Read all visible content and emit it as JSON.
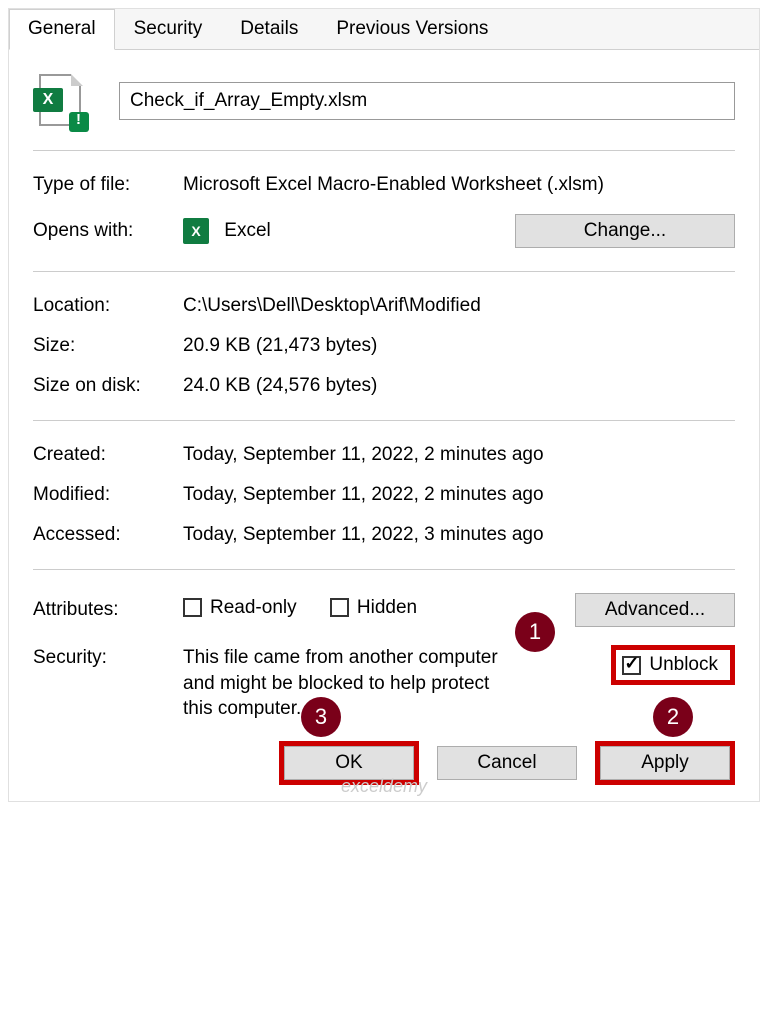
{
  "tabs": {
    "general": "General",
    "security": "Security",
    "details": "Details",
    "previous": "Previous Versions"
  },
  "filename": "Check_if_Array_Empty.xlsm",
  "rows": {
    "typeLabel": "Type of file:",
    "typeValue": "Microsoft Excel Macro-Enabled Worksheet (.xlsm)",
    "opensLabel": "Opens with:",
    "opensApp": "Excel",
    "changeBtn": "Change...",
    "locationLabel": "Location:",
    "locationValue": "C:\\Users\\Dell\\Desktop\\Arif\\Modified",
    "sizeLabel": "Size:",
    "sizeValue": "20.9 KB (21,473 bytes)",
    "diskLabel": "Size on disk:",
    "diskValue": "24.0 KB (24,576 bytes)",
    "createdLabel": "Created:",
    "createdValue": "Today, September 11, 2022, 2 minutes ago",
    "modifiedLabel": "Modified:",
    "modifiedValue": "Today, September 11, 2022, 2 minutes ago",
    "accessedLabel": "Accessed:",
    "accessedValue": "Today, September 11, 2022, 3 minutes ago",
    "attrLabel": "Attributes:",
    "readonly": "Read-only",
    "hidden": "Hidden",
    "advancedBtn": "Advanced...",
    "securityLabel": "Security:",
    "securityText": "This file came from another computer and might be blocked to help protect this computer.",
    "unblock": "Unblock"
  },
  "footer": {
    "ok": "OK",
    "cancel": "Cancel",
    "apply": "Apply"
  },
  "badges": {
    "b1": "1",
    "b2": "2",
    "b3": "3"
  },
  "watermark": "exceldemy"
}
